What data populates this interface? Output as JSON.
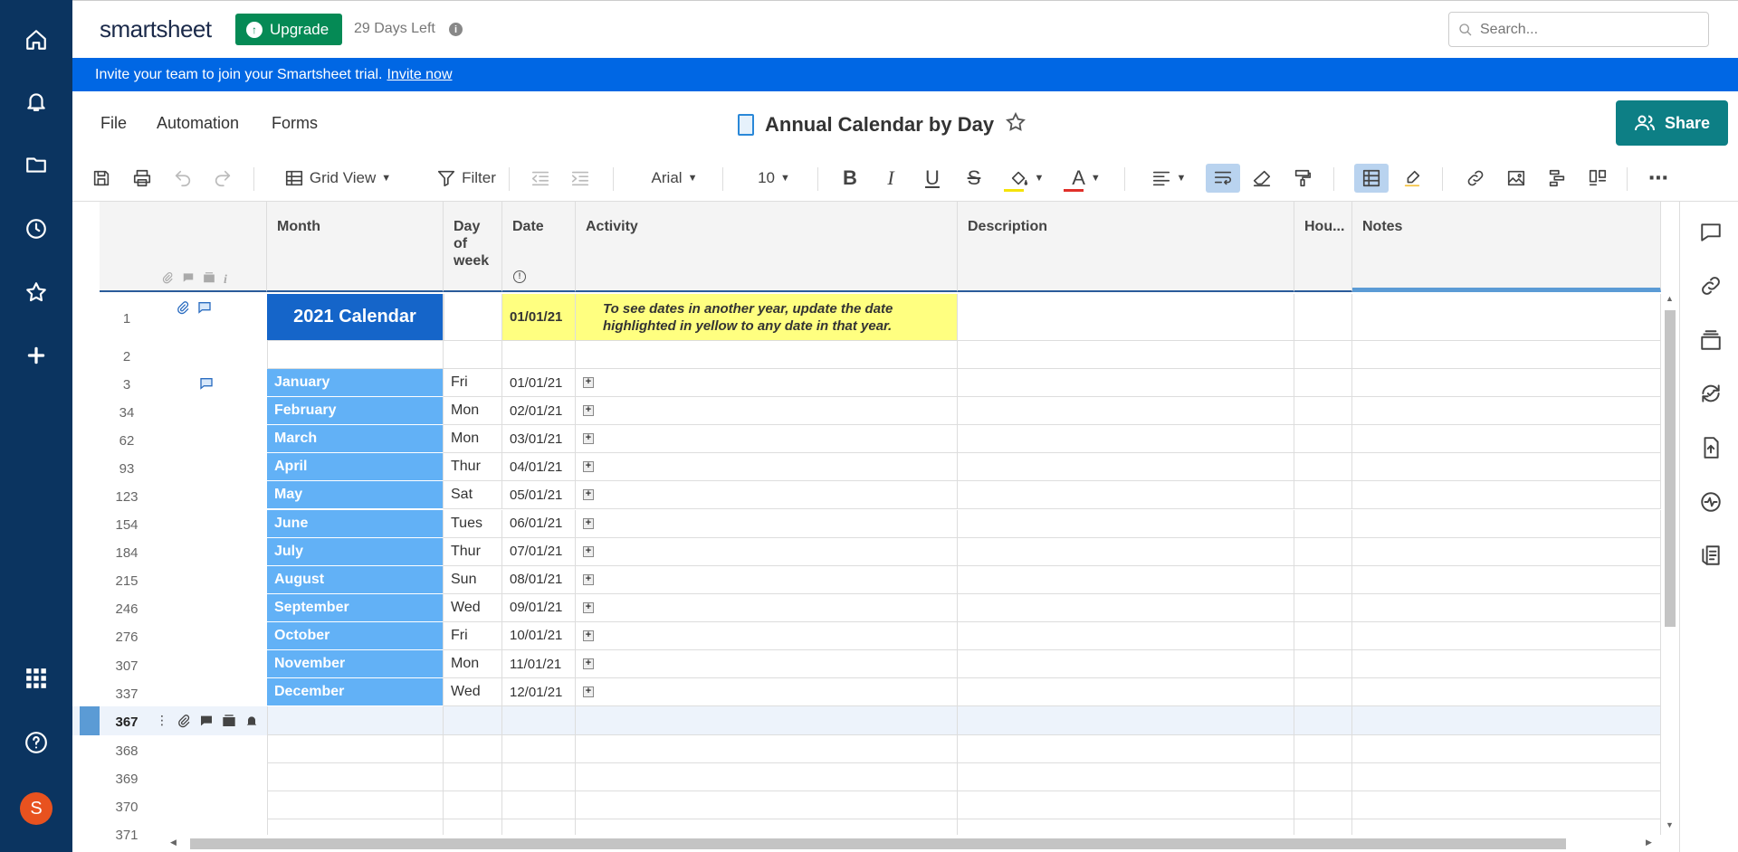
{
  "app": {
    "logo": "smartsheet",
    "upgrade_label": "Upgrade",
    "days_left": "29 Days Left",
    "search_placeholder": "Search...",
    "avatar_initial": "S"
  },
  "banner": {
    "text": "Invite your team to join your Smartsheet trial.",
    "link": "Invite now"
  },
  "menu": {
    "file": "File",
    "automation": "Automation",
    "forms": "Forms"
  },
  "sheet": {
    "title": "Annual Calendar by Day",
    "share_label": "Share"
  },
  "toolbar": {
    "view_label": "Grid View",
    "filter_label": "Filter",
    "font": "Arial",
    "font_size": "10",
    "fill_color": "#f5e30a",
    "text_color": "#e0302a"
  },
  "columns": [
    {
      "label": "Month"
    },
    {
      "label": "Day of week"
    },
    {
      "label": "Date"
    },
    {
      "label": "Activity"
    },
    {
      "label": "Description"
    },
    {
      "label": "Hou..."
    },
    {
      "label": "Notes"
    }
  ],
  "header_row": {
    "num": "1",
    "title": "2021 Calendar",
    "date": "01/01/21",
    "note": "To see dates in another year, update the date highlighted in yellow to any date in that year."
  },
  "row2_num": "2",
  "months": [
    {
      "num": "3",
      "month": "January",
      "dow": "Fri",
      "date": "01/01/21"
    },
    {
      "num": "34",
      "month": "February",
      "dow": "Mon",
      "date": "02/01/21"
    },
    {
      "num": "62",
      "month": "March",
      "dow": "Mon",
      "date": "03/01/21"
    },
    {
      "num": "93",
      "month": "April",
      "dow": "Thur",
      "date": "04/01/21"
    },
    {
      "num": "123",
      "month": "May",
      "dow": "Sat",
      "date": "05/01/21"
    },
    {
      "num": "154",
      "month": "June",
      "dow": "Tues",
      "date": "06/01/21"
    },
    {
      "num": "184",
      "month": "July",
      "dow": "Thur",
      "date": "07/01/21"
    },
    {
      "num": "215",
      "month": "August",
      "dow": "Sun",
      "date": "08/01/21"
    },
    {
      "num": "246",
      "month": "September",
      "dow": "Wed",
      "date": "09/01/21"
    },
    {
      "num": "276",
      "month": "October",
      "dow": "Fri",
      "date": "10/01/21"
    },
    {
      "num": "307",
      "month": "November",
      "dow": "Mon",
      "date": "11/01/21"
    },
    {
      "num": "337",
      "month": "December",
      "dow": "Wed",
      "date": "12/01/21"
    }
  ],
  "selected_row": {
    "num": "367"
  },
  "empty_rows": [
    "368",
    "369",
    "370",
    "371"
  ],
  "colors": {
    "nav_bg": "#0b3460",
    "banner_bg": "#0067e4",
    "month_cell": "#62b1f6",
    "title_cell": "#1565c9",
    "highlight": "#ffff80",
    "share_bg": "#0d7f85",
    "upgrade_bg": "#058a55"
  }
}
